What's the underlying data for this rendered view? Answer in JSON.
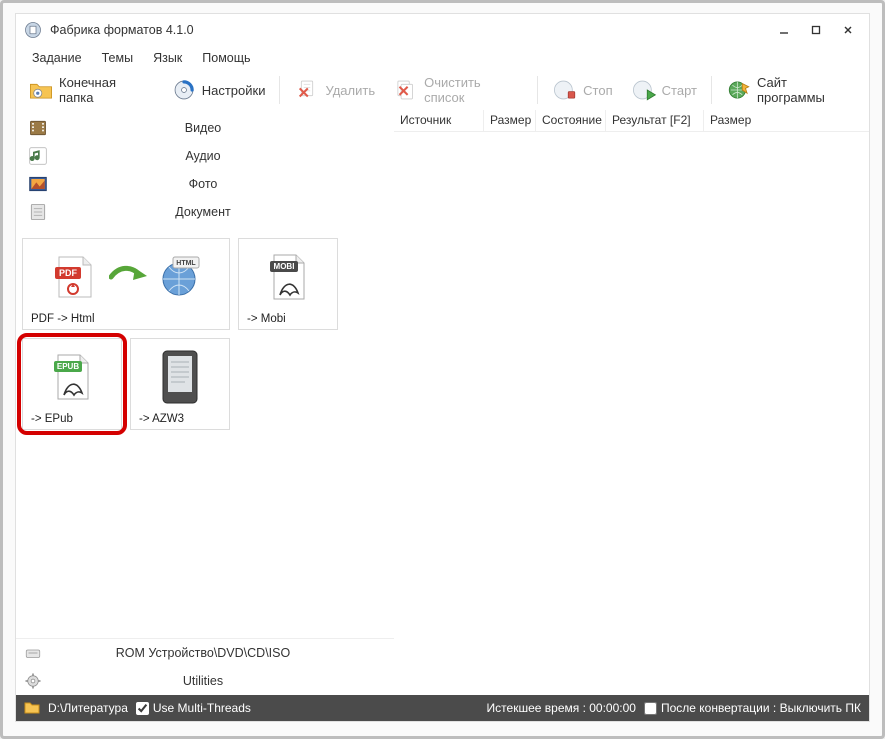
{
  "title": "Фабрика форматов 4.1.0",
  "menu": {
    "task": "Задание",
    "themes": "Темы",
    "lang": "Язык",
    "help": "Помощь"
  },
  "toolbar": {
    "dest": "Конечная папка",
    "settings": "Настройки",
    "delete": "Удалить",
    "clear": "Очистить список",
    "stop": "Стоп",
    "start": "Старт",
    "site": "Сайт программы"
  },
  "categories": {
    "video": "Видео",
    "audio": "Аудио",
    "photo": "Фото",
    "doc": "Документ"
  },
  "tiles": {
    "pdf_html": "PDF -> Html",
    "mobi": "-> Mobi",
    "epub": "-> EPub",
    "azw3": "-> AZW3",
    "badge_pdf": "PDF",
    "badge_html": "HTML",
    "badge_mobi": "MOBI",
    "badge_epub": "EPUB"
  },
  "leftbottom": {
    "rom": "ROM Устройство\\DVD\\CD\\ISO",
    "util": "Utilities"
  },
  "table": {
    "source": "Источник",
    "size1": "Размер",
    "state": "Состояние",
    "result": "Результат [F2]",
    "size2": "Размер"
  },
  "status": {
    "path": "D:\\Литература",
    "multithreads": "Use Multi-Threads",
    "elapsed": "Истекшее время : 00:00:00",
    "postconv": "После конвертации : Выключить ПК"
  }
}
